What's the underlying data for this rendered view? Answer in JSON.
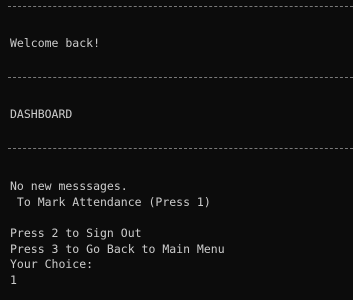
{
  "console": {
    "welcome": "Welcome back!",
    "dashboard_title": "DASHBOARD",
    "no_messages": "No new messsages.",
    "mark_attendance": " To Mark Attendance (Press 1)",
    "sign_out": "Press 2 to Sign Out",
    "main_menu": "Press 3 to Go Back to Main Menu",
    "prompt": "Your Choice:",
    "input_value": "1"
  }
}
